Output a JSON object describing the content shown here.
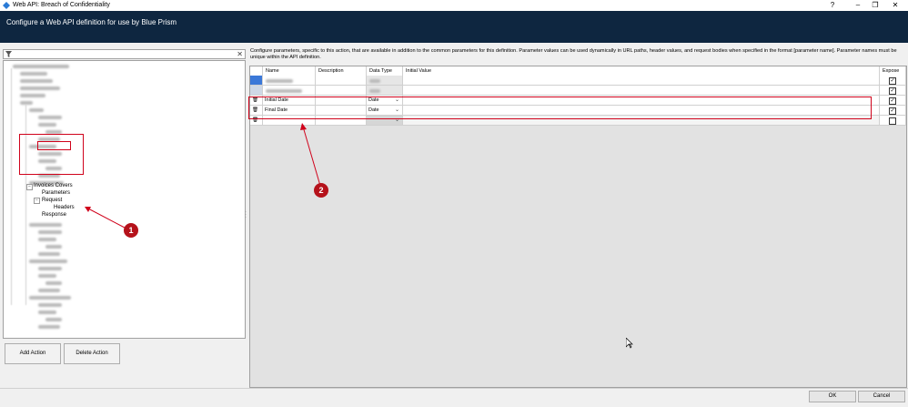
{
  "window": {
    "title": "Web API: Breach of Confidentiality",
    "help": "?"
  },
  "header": {
    "text": "Configure a Web API definition for use by Blue Prism"
  },
  "tree": {
    "selected_parent": "Invoices Covers",
    "selected_child": "Parameters",
    "request": "Request",
    "headers": "Headers",
    "response": "Response"
  },
  "buttons": {
    "add_action": "Add Action",
    "delete_action": "Delete Action",
    "ok": "OK",
    "cancel": "Cancel"
  },
  "description": "Configure parameters, specific to this action, that are available in addition to the common parameters for this definition. Parameter values can be used dynamically in URL paths, header values, and request bodies when specified in the format [parameter name]. Parameter names must be unique within the API definition.",
  "grid": {
    "columns": {
      "name": "Name",
      "description": "Description",
      "data_type": "Data Type",
      "initial_value": "Initial Value",
      "expose": "Expose"
    },
    "rows": [
      {
        "name": "Initial Date",
        "description": "",
        "data_type": "Date",
        "initial_value": "",
        "expose": true
      },
      {
        "name": "Final Date",
        "description": "",
        "data_type": "Date",
        "initial_value": "",
        "expose": true
      },
      {
        "name": "",
        "description": "",
        "data_type": "",
        "initial_value": "",
        "expose": false
      }
    ]
  },
  "callouts": {
    "one": "1",
    "two": "2"
  },
  "colors": {
    "header": "#0e2640",
    "highlight": "#d0021b",
    "callout": "#b5121b"
  }
}
